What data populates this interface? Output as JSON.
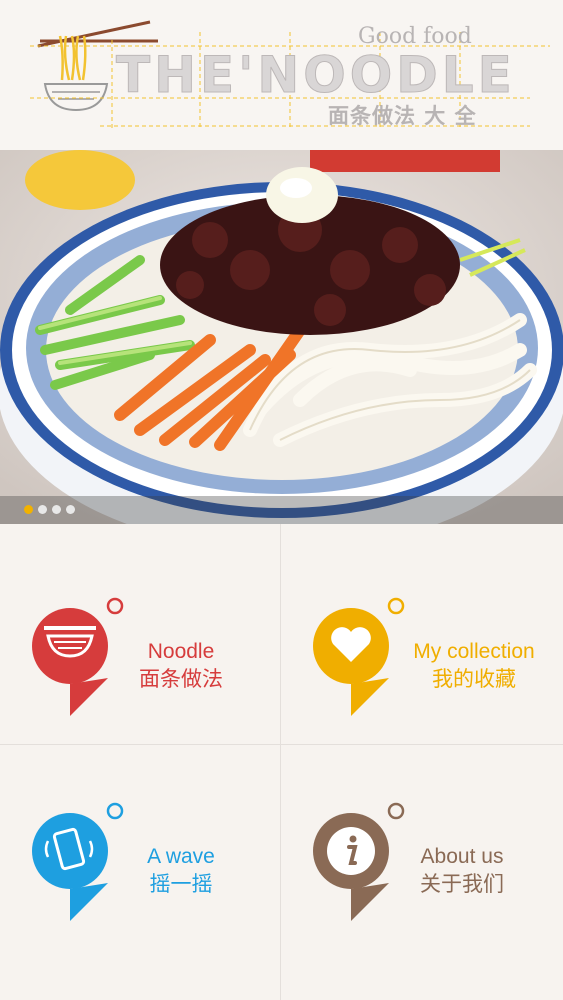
{
  "header": {
    "title": "THE'NOODLE",
    "tagline": "Good food",
    "subtitle": "面条做法 大 全"
  },
  "banner": {
    "image_icon": "noodle-dish-photo",
    "dots": 4,
    "active_dot": 0
  },
  "menu": [
    {
      "en": "Noodle",
      "zh": "面条做法",
      "color": "#d63c3c",
      "icon": "noodle-bowl-icon"
    },
    {
      "en": "My collection",
      "zh": "我的收藏",
      "color": "#f0ae00",
      "icon": "heart-icon"
    },
    {
      "en": "A wave",
      "zh": "摇一摇",
      "color": "#1e9fe0",
      "icon": "shake-phone-icon"
    },
    {
      "en": "About us",
      "zh": "关于我们",
      "color": "#8a6a55",
      "icon": "info-icon"
    }
  ]
}
